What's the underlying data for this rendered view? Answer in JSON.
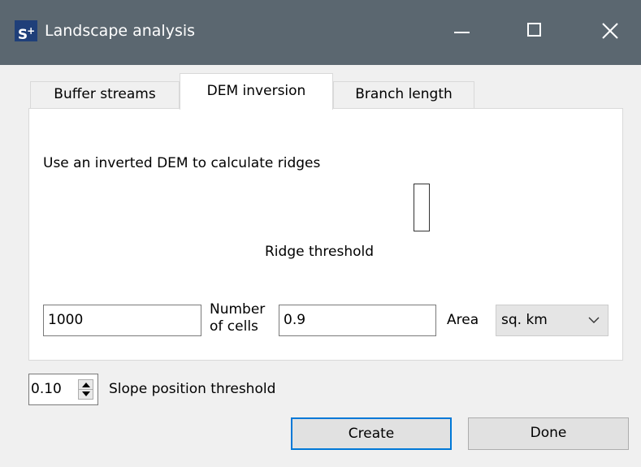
{
  "window": {
    "title": "Landscape analysis",
    "app_icon_text": "S",
    "app_icon_sup": "+"
  },
  "tabs": [
    {
      "label": "Buffer streams",
      "active": false
    },
    {
      "label": "DEM inversion",
      "active": true
    },
    {
      "label": "Branch length",
      "active": false
    }
  ],
  "dem_inversion": {
    "description": "Use an inverted DEM to calculate ridges",
    "ridge_threshold_label": "Ridge threshold",
    "cells_value": "1000",
    "cells_label_line1": "Number",
    "cells_label_line2": "of cells",
    "area_value": "0.9",
    "area_label": "Area",
    "unit_selected": "sq. km"
  },
  "slope": {
    "value": "0.10",
    "label": "Slope position threshold"
  },
  "buttons": {
    "create": "Create",
    "done": "Done"
  },
  "colors": {
    "titlebar": "#5b6770",
    "app_icon": "#1f3f79",
    "focus_border": "#0078d7"
  }
}
